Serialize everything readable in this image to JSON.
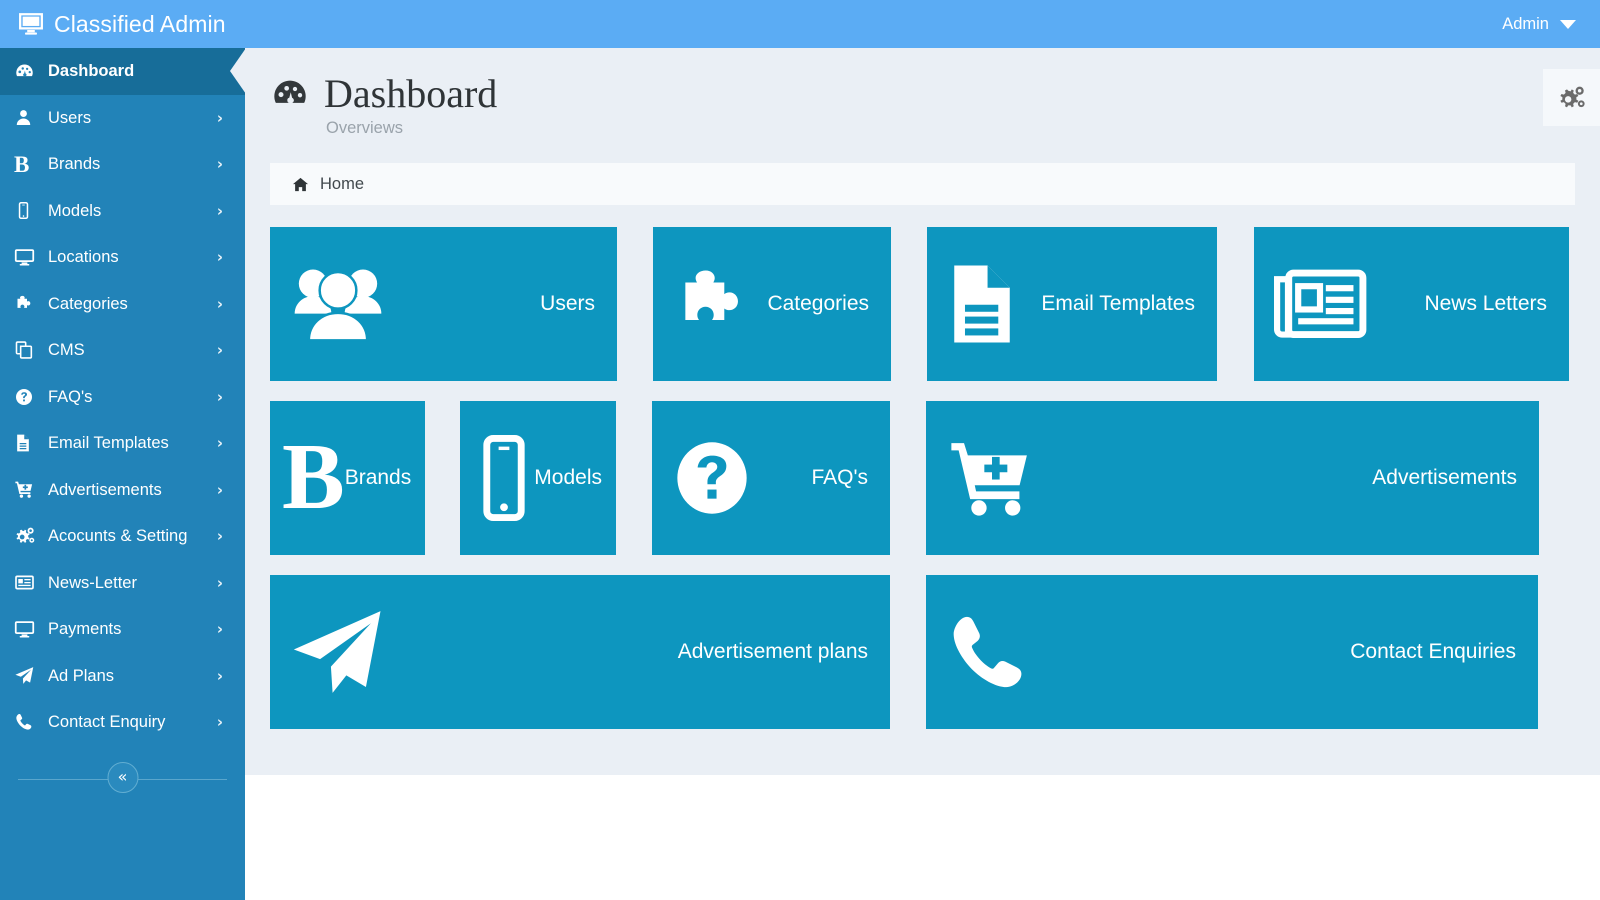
{
  "topbar": {
    "brand_title": "Classified Admin",
    "brand_icon": "desktop-icon",
    "user_label": "Admin",
    "user_caret_icon": "caret-down-icon"
  },
  "sidebar": {
    "background_color": "#2283b8",
    "active_color": "#176d99",
    "collapse_label": "«",
    "items": [
      {
        "label": "Dashboard",
        "icon": "dashboard-icon",
        "arrow": "",
        "active": true
      },
      {
        "label": "Users",
        "icon": "user-icon",
        "arrow": "›",
        "active": false
      },
      {
        "label": "Brands",
        "icon": "bold-b-icon",
        "arrow": "›",
        "active": false
      },
      {
        "label": "Models",
        "icon": "mobile-icon",
        "arrow": "›",
        "active": false
      },
      {
        "label": "Locations",
        "icon": "desktop-icon",
        "arrow": "›",
        "active": false
      },
      {
        "label": "Categories",
        "icon": "puzzle-icon",
        "arrow": "›",
        "active": false
      },
      {
        "label": "CMS",
        "icon": "copy-files-icon",
        "arrow": "›",
        "active": false
      },
      {
        "label": "FAQ's",
        "icon": "question-circle-icon",
        "arrow": "›",
        "active": false
      },
      {
        "label": "Email Templates",
        "icon": "file-text-icon",
        "arrow": "›",
        "active": false
      },
      {
        "label": "Advertisements",
        "icon": "cart-plus-icon",
        "arrow": "›",
        "active": false
      },
      {
        "label": "Acocunts & Setting",
        "icon": "gears-icon",
        "arrow": "›",
        "active": false
      },
      {
        "label": "News-Letter",
        "icon": "newspaper-icon",
        "arrow": "›",
        "active": false
      },
      {
        "label": "Payments",
        "icon": "desktop-icon",
        "arrow": "›",
        "active": false
      },
      {
        "label": "Ad Plans",
        "icon": "paper-plane-icon",
        "arrow": "›",
        "active": false
      },
      {
        "label": "Contact Enquiry",
        "icon": "phone-icon",
        "arrow": "›",
        "active": false
      }
    ]
  },
  "page": {
    "title": "Dashboard",
    "title_icon": "dashboard-icon",
    "subtitle": "Overviews",
    "settings_icon": "gears-icon",
    "breadcrumb": {
      "icon": "home-icon",
      "label": "Home"
    },
    "content_background": "#eaeff5",
    "tile_color": "#0d96bf"
  },
  "tiles": {
    "row1": [
      {
        "label": "Users",
        "icon": "users-group-icon"
      },
      {
        "label": "Categories",
        "icon": "puzzle-icon"
      },
      {
        "label": "Email Templates",
        "icon": "file-text-icon"
      },
      {
        "label": "News Letters",
        "icon": "newspaper-icon"
      }
    ],
    "row2": [
      {
        "label": "Brands",
        "icon": "bold-b-icon"
      },
      {
        "label": "Models",
        "icon": "mobile-icon"
      },
      {
        "label": "FAQ's",
        "icon": "question-circle-icon"
      },
      {
        "label": "Advertisements",
        "icon": "cart-plus-icon"
      }
    ],
    "row3": [
      {
        "label": "Advertisement plans",
        "icon": "paper-plane-icon"
      },
      {
        "label": "Contact Enquiries",
        "icon": "phone-icon"
      }
    ]
  }
}
